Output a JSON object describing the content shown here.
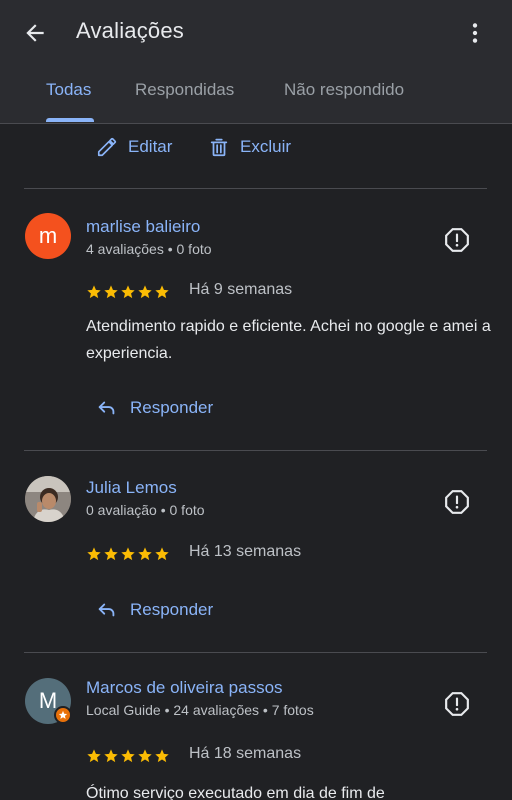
{
  "header": {
    "title": "Avaliações",
    "back_icon": "arrow-back-icon",
    "more_icon": "more-vert-icon"
  },
  "tabs": [
    {
      "label": "Todas",
      "active": true
    },
    {
      "label": "Respondidas",
      "active": false
    },
    {
      "label": "Não respondido",
      "active": false
    }
  ],
  "owner_actions": {
    "edit_label": "Editar",
    "delete_label": "Excluir"
  },
  "reviews": [
    {
      "name": "marlise balieiro",
      "avatar_initial": "m",
      "avatar_color": "#f4511e",
      "meta": "4 avaliações • 0 foto",
      "rating": 5,
      "date": "Há 9 semanas",
      "text": "Atendimento rapido e eficiente. Achei no google e amei a experiencia.",
      "reply_label": "Responder"
    },
    {
      "name": "Julia Lemos",
      "avatar_initial": "",
      "avatar_color": "#5f5a55",
      "meta": "0 avaliação • 0 foto",
      "rating": 5,
      "date": "Há 13 semanas",
      "text": "",
      "reply_label": "Responder"
    },
    {
      "name": "Marcos de oliveira passos",
      "avatar_initial": "M",
      "avatar_color": "#546e7a",
      "meta": "Local Guide • 24 avaliações • 7 fotos",
      "rating": 5,
      "date": "Há 18 semanas",
      "text": "Ótimo serviço executado em dia de fim de",
      "reply_label": ""
    }
  ],
  "colors": {
    "background": "#202124",
    "header": "#2b2c30",
    "accent": "#8ab4f8",
    "star": "#fbbc04",
    "text": "#e8eaed",
    "muted": "#bdc1c6"
  }
}
